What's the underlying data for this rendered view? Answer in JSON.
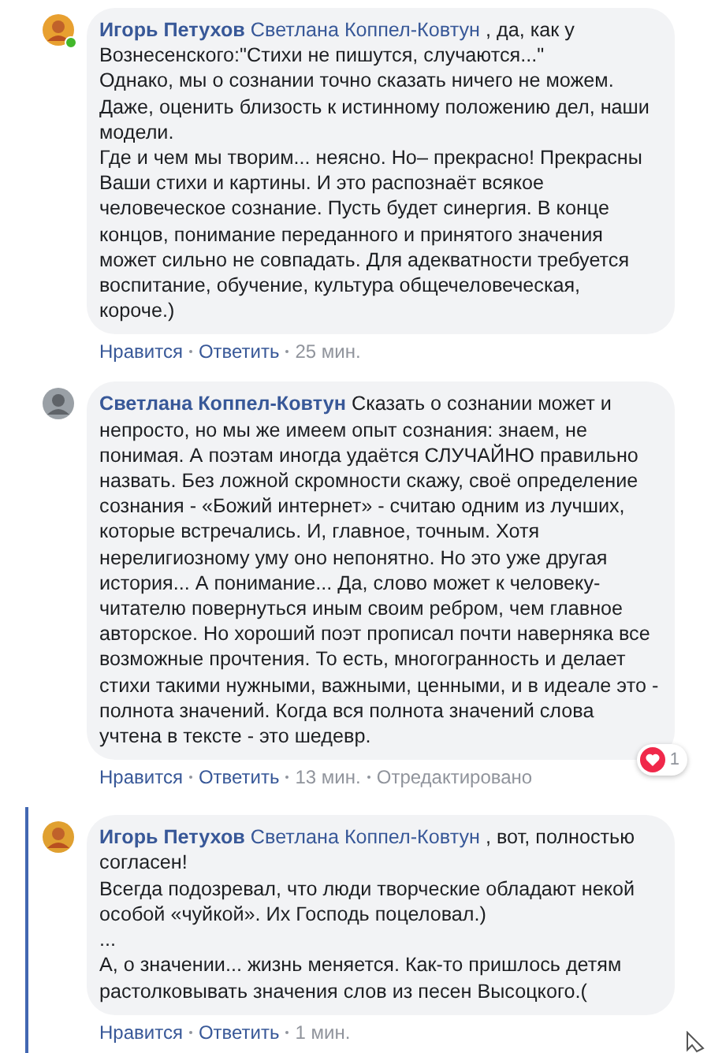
{
  "comments": [
    {
      "author": "Игорь Петухов",
      "mention": "Светлана Коппел-Ковтун",
      "text": " , да, как у Вознесенского:\"Стихи не пишутся, случаются...\"\nОднако, мы о сознании точно сказать ничего не можем.\nДаже, оценить близость к истинному положению дел, наши модели.\nГде и чем мы творим... неясно. Но– прекрасно! Прекрасны Ваши стихи и картины. И это распознаёт всякое человеческое сознание. Пусть будет синергия. В конце концов, понимание переданного и принятого значения может сильно не совпадать. Для адекватности требуется воспитание, обучение, культура общечеловеческая, короче.)",
      "online": true,
      "highlighted": false,
      "actions": [
        "Нравится",
        "Ответить"
      ],
      "time": "25 мин."
    },
    {
      "author": "Светлана Коппел-Ковтун",
      "text": " Сказать о сознании может и непросто, но мы же имеем опыт сознания: знаем, не понимая. А поэтам иногда удаётся СЛУЧАЙНО правильно назвать. Без ложной скромности скажу, своё определение сознания - «Божий интернет» - считаю одним из лучших, которые встречались. И, главное, точным. Хотя нерелигиозному уму оно непонятно. Но это уже другая история... А понимание... Да, слово может к человеку-читателю повернуться иным своим ребром, чем главное авторское. Но хороший поэт прописал почти наверняка все возможные прочтения. То есть, многогранность и делает стихи такими нужными, важными, ценными, и в идеале это - полнота значений. Когда вся полнота значений слова учтена в тексте - это шедевр.",
      "online": false,
      "highlighted": false,
      "actions": [
        "Нравится",
        "Ответить"
      ],
      "time": "13 мин.",
      "edited": "Отредактировано",
      "reactions": "1"
    },
    {
      "author": "Игорь Петухов",
      "mention": "Светлана Коппел-Ковтун",
      "text": " , вот, полностью согласен!\nВсегда подозревал, что люди творческие обладают некой особой «чуйкой». Их Господь поцеловал.)\n...\nА, о значении... жизнь меняется. Как-то пришлось детям растолковывать значения слов из песен Высоцкого.(",
      "online": false,
      "highlighted": true,
      "actions": [
        "Нравится",
        "Ответить"
      ],
      "time": "1 мин."
    }
  ]
}
